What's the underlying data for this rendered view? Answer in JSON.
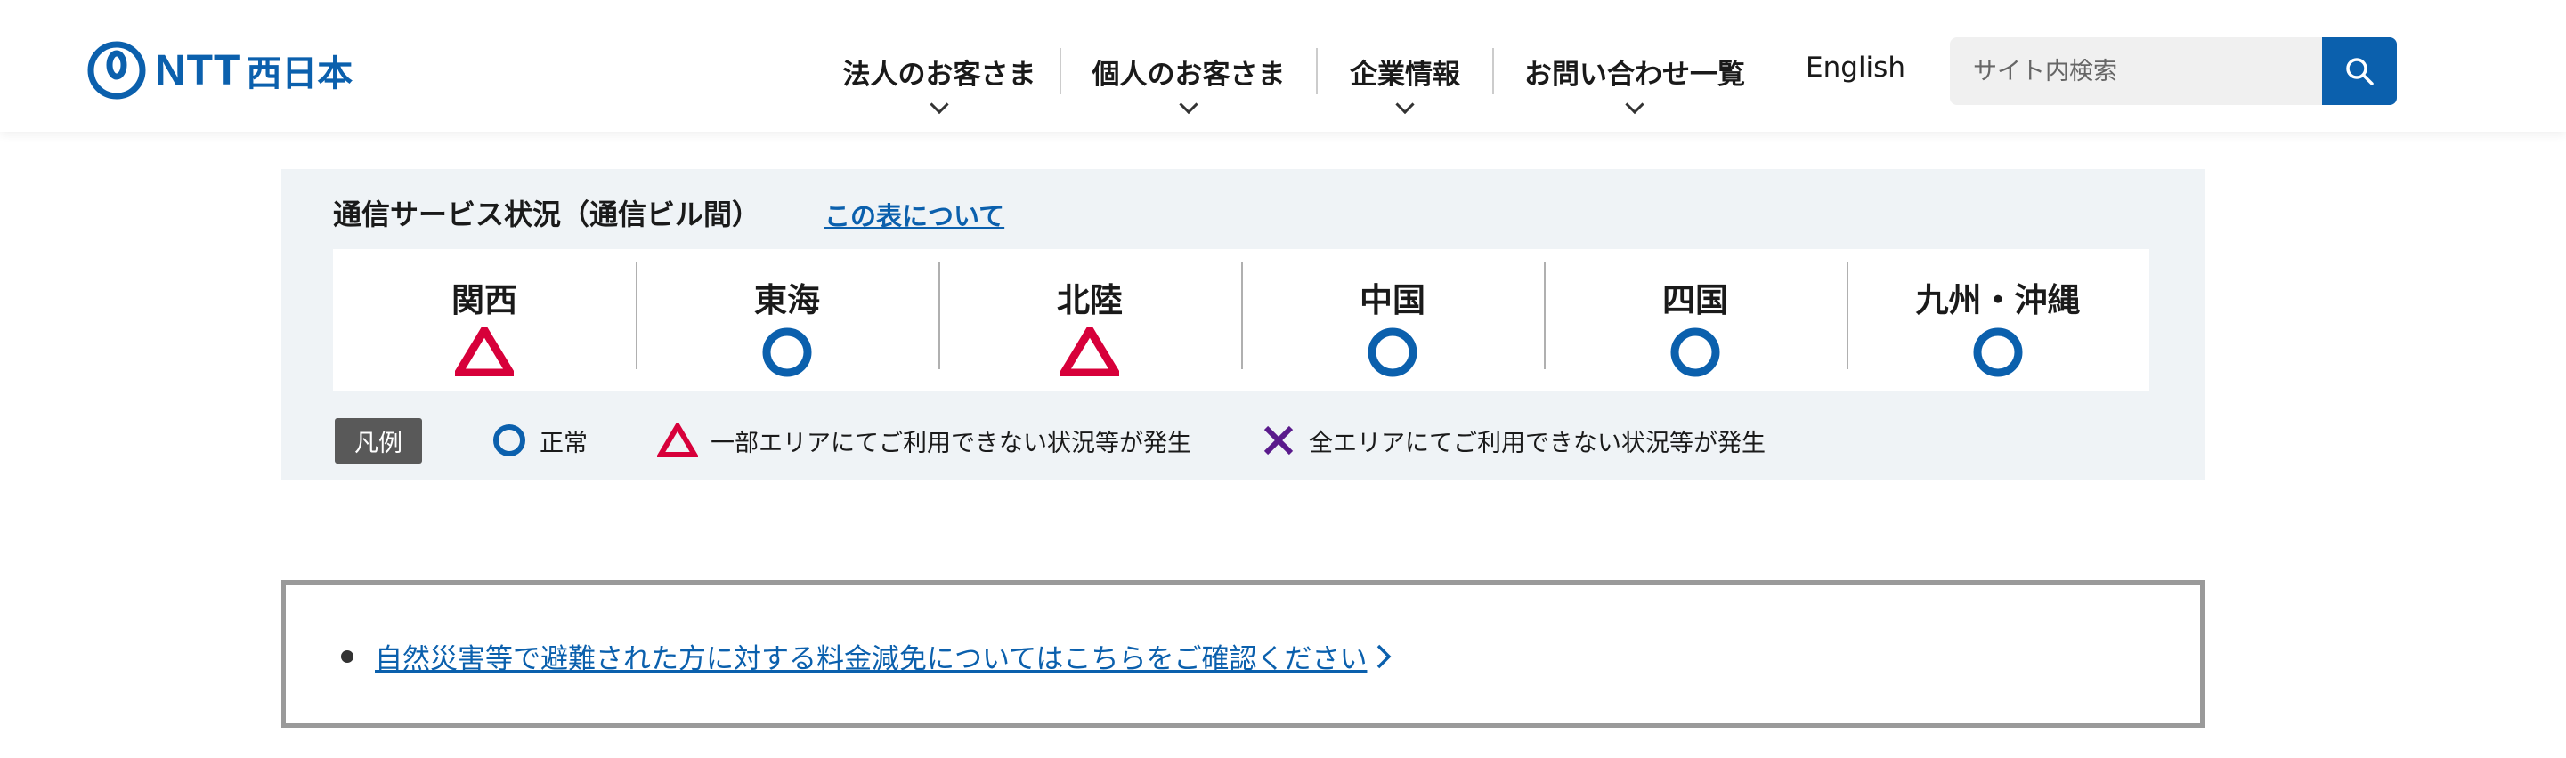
{
  "header": {
    "logo_text": "NTT",
    "logo_text_jp": "西日本",
    "nav": [
      {
        "label": "法人のお客さま",
        "has_dropdown": true
      },
      {
        "label": "個人のお客さま",
        "has_dropdown": true
      },
      {
        "label": "企業情報",
        "has_dropdown": true
      },
      {
        "label": "お問い合わせ一覧",
        "has_dropdown": true
      },
      {
        "label": "English",
        "has_dropdown": false
      }
    ],
    "search": {
      "placeholder": "サイト内検索",
      "button_icon": "search-icon"
    }
  },
  "status": {
    "title": "通信サービス状況（通信ビル間）",
    "about_link": "この表について",
    "regions": [
      {
        "name": "関西",
        "status": "partial"
      },
      {
        "name": "東海",
        "status": "normal"
      },
      {
        "name": "北陸",
        "status": "partial"
      },
      {
        "name": "中国",
        "status": "normal"
      },
      {
        "name": "四国",
        "status": "normal"
      },
      {
        "name": "九州・沖縄",
        "status": "normal"
      }
    ],
    "legend": {
      "tag": "凡例",
      "items": [
        {
          "icon": "circle-icon",
          "label": "正常"
        },
        {
          "icon": "triangle-icon",
          "label": "一部エリアにてご利用できない状況等が発生"
        },
        {
          "icon": "cross-icon",
          "label": "全エリアにてご利用できない状況等が発生"
        }
      ]
    }
  },
  "notice": {
    "link_text": "自然災害等で避難された方に対する料金減免についてはこちらをご確認ください"
  },
  "colors": {
    "brand_blue": "#0b60ad",
    "partial_red": "#d7003a",
    "outage_purple": "#5a1a8c",
    "panel_bg": "#eff3f6"
  }
}
